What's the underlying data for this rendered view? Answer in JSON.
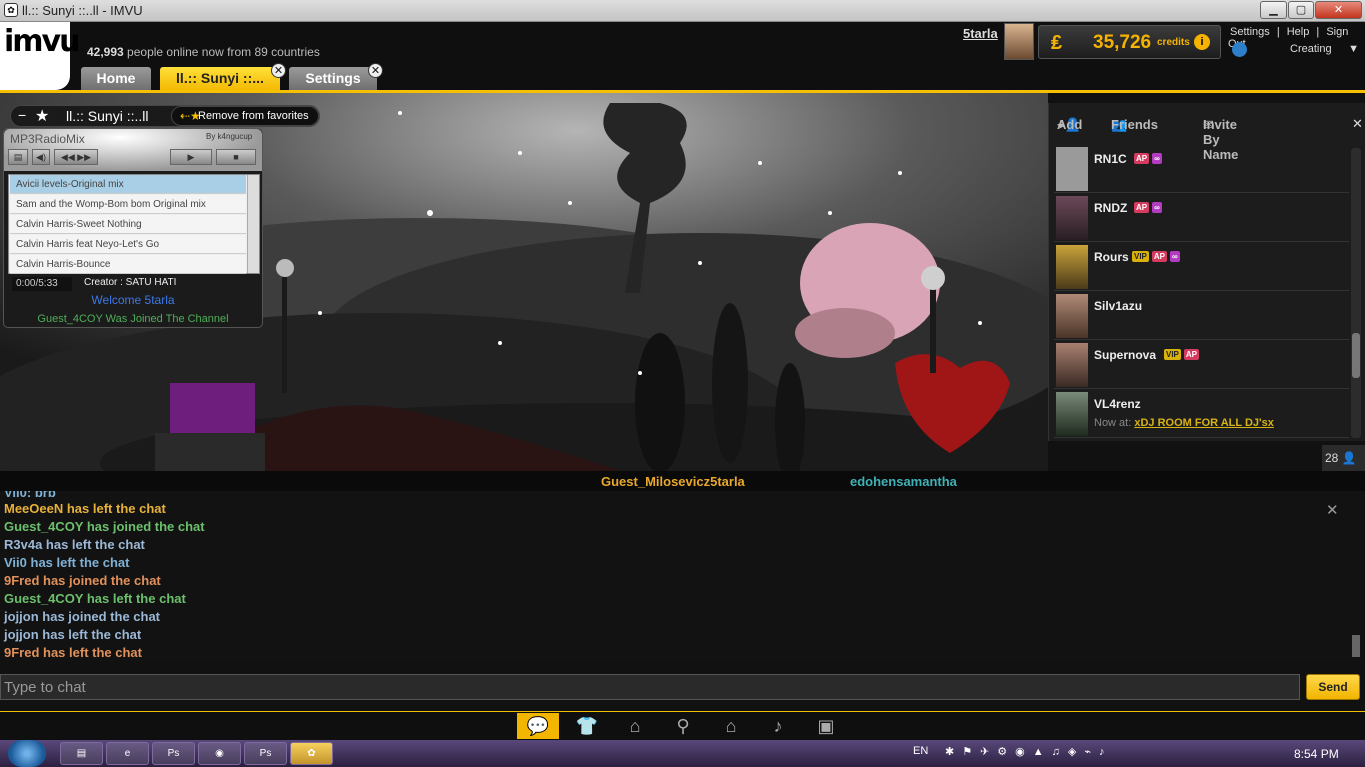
{
  "window": {
    "title": "ll.:: Sunyi ::..ll - IMVU",
    "min": "▁",
    "max": "▢",
    "close": "✕"
  },
  "header": {
    "logo": "imvu",
    "online_count": "42,993",
    "online_text": "people online now from 89 countries",
    "username": "5tarla",
    "credits": "35,726",
    "credits_label": "credits",
    "links": [
      "Settings",
      "|",
      "Help",
      "|",
      "Sign Out"
    ],
    "status": "Creating"
  },
  "tabs": [
    {
      "label": "Home"
    },
    {
      "label": "ll.:: Sunyi ::..."
    },
    {
      "label": "Settings"
    }
  ],
  "room": {
    "name": "ll.:: Sunyi ::..ll",
    "remove_fav": "Remove from favorites"
  },
  "mp3": {
    "title": "MP3RadioMix",
    "by": "By k4ngucup",
    "playlist": [
      "Avicii levels-Original mix",
      "Sam and the Womp-Bom bom Original mix",
      "Calvin Harris-Sweet Nothing",
      "Calvin Harris feat Neyo-Let's Go",
      "Calvin Harris-Bounce"
    ],
    "time": "0:00/5:33",
    "creator": "Creator : SATU HATI",
    "welcome": "Welcome 5tarla",
    "joined": "Guest_4COY Was Joined The Channel"
  },
  "friends": {
    "add": "Add",
    "friends": "Friends",
    "invite": "Invite By Name",
    "list": [
      {
        "name": "RN1C",
        "badges": [
          "AP",
          "∞"
        ],
        "color": "#9a9a9a"
      },
      {
        "name": "RNDZ",
        "badges": [
          "AP",
          "∞"
        ],
        "color": "#6b4a58"
      },
      {
        "name": "Rours",
        "badges": [
          "VIP",
          "AP",
          "∞"
        ],
        "color": "#c9a33a"
      },
      {
        "name": "Silv1azu",
        "badges": [],
        "color": "#7a5a4a"
      },
      {
        "name": "Supernova",
        "badges": [
          "VIP",
          "AP"
        ],
        "color": "#8a6c60"
      },
      {
        "name": "VL4renz",
        "badges": [],
        "color": "#5a6a5a",
        "now_at_label": "Now at:",
        "now_at": "xDJ ROOM FOR ALL DJ'sx"
      }
    ],
    "user_count": "28"
  },
  "scene_names": {
    "left": "Guest_Milosevicz5tarla",
    "right": "edohensamantha"
  },
  "chat": {
    "lines": [
      {
        "text": "Vii0: brb",
        "color": "#7fb2d6"
      },
      {
        "text": "MeeOeeN has left the chat",
        "color": "#e8b13a"
      },
      {
        "text": "Guest_4COY has joined the chat",
        "color": "#6cbf6c"
      },
      {
        "text": "R3v4a has left the chat",
        "color": "#9bb8d6"
      },
      {
        "text": "Vii0 has left the chat",
        "color": "#7fb2d6"
      },
      {
        "text": "9Fred has joined the chat",
        "color": "#e2915a"
      },
      {
        "text": "Guest_4COY has left the chat",
        "color": "#6cbf6c"
      },
      {
        "text": "jojjon has joined the chat",
        "color": "#9bb8d6"
      },
      {
        "text": "jojjon has left the chat",
        "color": "#9bb8d6"
      },
      {
        "text": "9Fred has left the chat",
        "color": "#e2915a"
      }
    ],
    "placeholder": "Type to chat",
    "send": "Send"
  },
  "taskbar": {
    "lang": "EN",
    "time": "8:54 PM"
  }
}
